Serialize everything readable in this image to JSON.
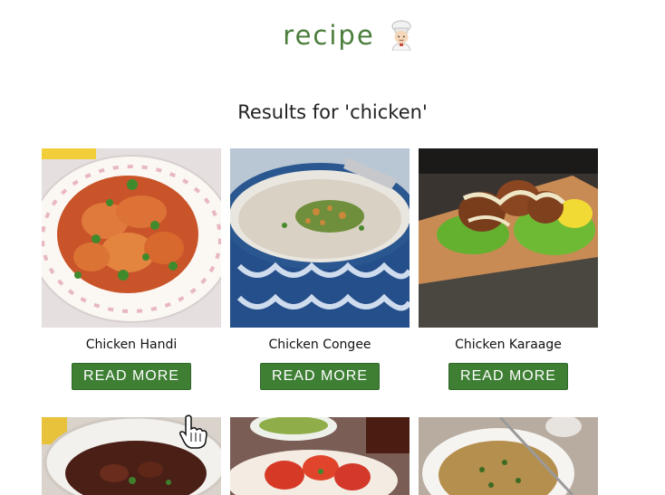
{
  "app": {
    "logo_text": "recipe",
    "logo_icon": "chef-emoji-icon"
  },
  "results": {
    "heading": "Results for 'chicken'"
  },
  "cards": [
    {
      "title": "Chicken Handi",
      "button": "READ MORE"
    },
    {
      "title": "Chicken Congee",
      "button": "READ MORE"
    },
    {
      "title": "Chicken Karaage",
      "button": "READ MORE"
    },
    {
      "title": "",
      "button": ""
    },
    {
      "title": "",
      "button": ""
    },
    {
      "title": "",
      "button": ""
    }
  ],
  "colors": {
    "brand_green": "#4a7d3a",
    "button_green": "#3e7f34"
  }
}
